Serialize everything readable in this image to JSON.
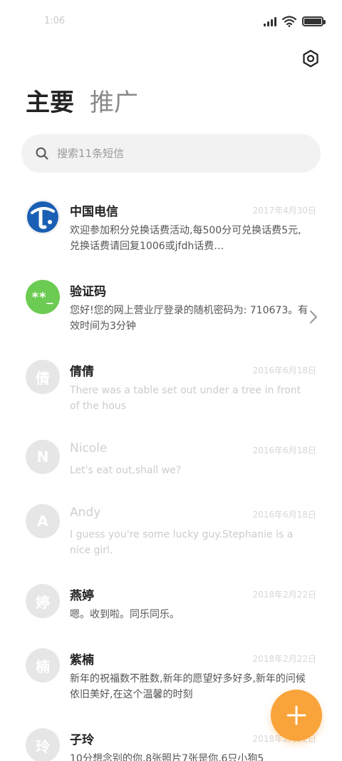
{
  "status_bar": {
    "time": "1:06",
    "icons": [
      "signal-icon",
      "wifi-icon",
      "battery-icon"
    ]
  },
  "header": {
    "settings_icon": "gear-icon",
    "tabs": [
      {
        "label": "主要",
        "active": true
      },
      {
        "label": "推广",
        "active": false
      }
    ]
  },
  "search": {
    "placeholder": "搜索11条短信",
    "icon": "search-icon"
  },
  "messages": [
    {
      "name": "中国电信",
      "date": "2017年4月30日",
      "preview": "欢迎参加积分兑换话费活动,每500分可兑换话费5元,兑换话费请回复1006或jfdh话费…",
      "avatar_type": "telecom"
    },
    {
      "name": "验证码",
      "date": "",
      "preview": "您好!您的网上营业厅登录的随机密码为: 710673。有效时间为3分钟",
      "avatar_type": "code",
      "avatar_text": "**_"
    },
    {
      "name": "倩倩",
      "date": "2016年6月18日",
      "preview": "There was a table set out under a tree in front of the hous",
      "avatar_text": "倩"
    },
    {
      "name": "Nicole",
      "date": "2016年6月18日",
      "preview": "Let's eat out,shall we?",
      "avatar_text": "N"
    },
    {
      "name": "Andy",
      "date": "2016年6月18日",
      "preview": "I guess you're some lucky guy.Stephanie is a nice girl.",
      "avatar_text": "A"
    },
    {
      "name": "燕婷",
      "date": "2018年2月22日",
      "preview": "嗯。收到啦。同乐同乐。",
      "avatar_text": "婷"
    },
    {
      "name": "紫楠",
      "date": "2018年2月22日",
      "preview": "新年的祝福数不胜数,新年的愿望好多好多,新年的问候依旧美好,在这个温馨的时刻",
      "avatar_text": "楠"
    },
    {
      "name": "子玲",
      "date": "2018年2月22日",
      "preview": "10分想念别的你,8张照片7张是你,6只小狗5",
      "avatar_text": "玲"
    }
  ],
  "fab": {
    "icon": "plus-icon"
  },
  "colors": {
    "accent": "#f9a33b",
    "code_avatar": "#6ccb52",
    "telecom_blue": "#1a5fb4"
  }
}
